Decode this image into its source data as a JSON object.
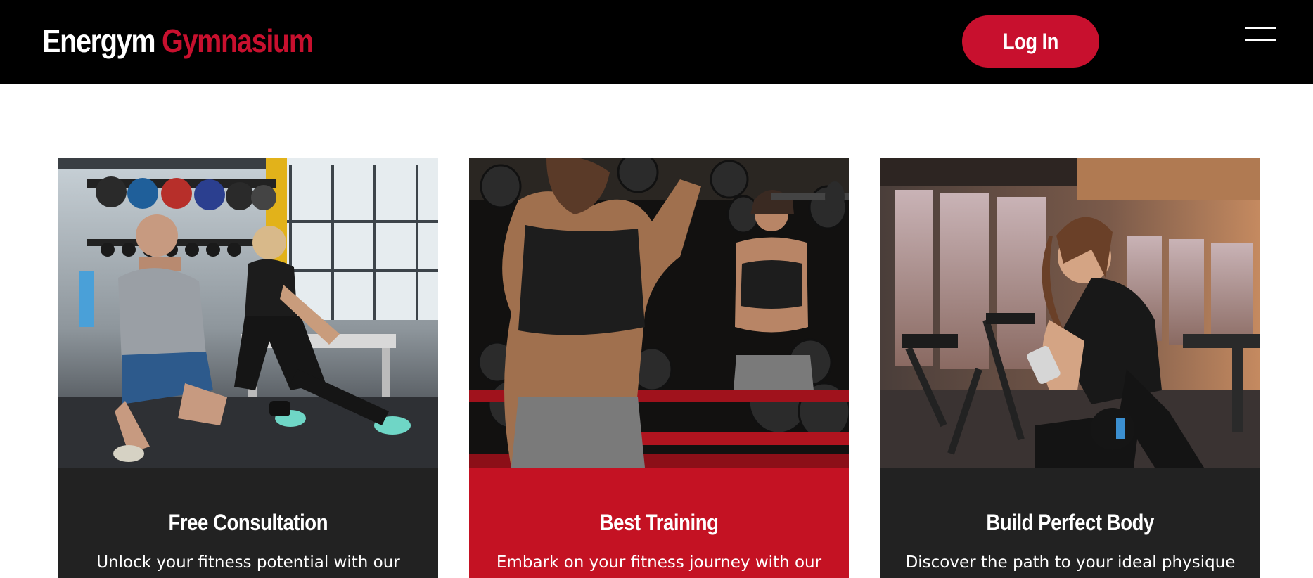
{
  "header": {
    "brand_primary": "Energym",
    "brand_accent": "Gymnasium",
    "login_label": "Log In",
    "menu_icon": "hamburger-menu-icon",
    "colors": {
      "background": "#000000",
      "accent": "#c8102e",
      "text": "#ffffff"
    }
  },
  "cards": [
    {
      "title": "Free Consultation",
      "description": "Unlock your fitness potential with our",
      "image": "trainer-coaching-woman-photo",
      "body_color": "#222222"
    },
    {
      "title": "Best Training",
      "description": "Embark on your fitness journey with our",
      "image": "woman-lifting-dumbbells-mirror-photo",
      "body_color": "#c41223"
    },
    {
      "title": "Build Perfect Body",
      "description": "Discover the path to your ideal physique",
      "image": "woman-checking-phone-gym-photo",
      "body_color": "#222222"
    }
  ]
}
